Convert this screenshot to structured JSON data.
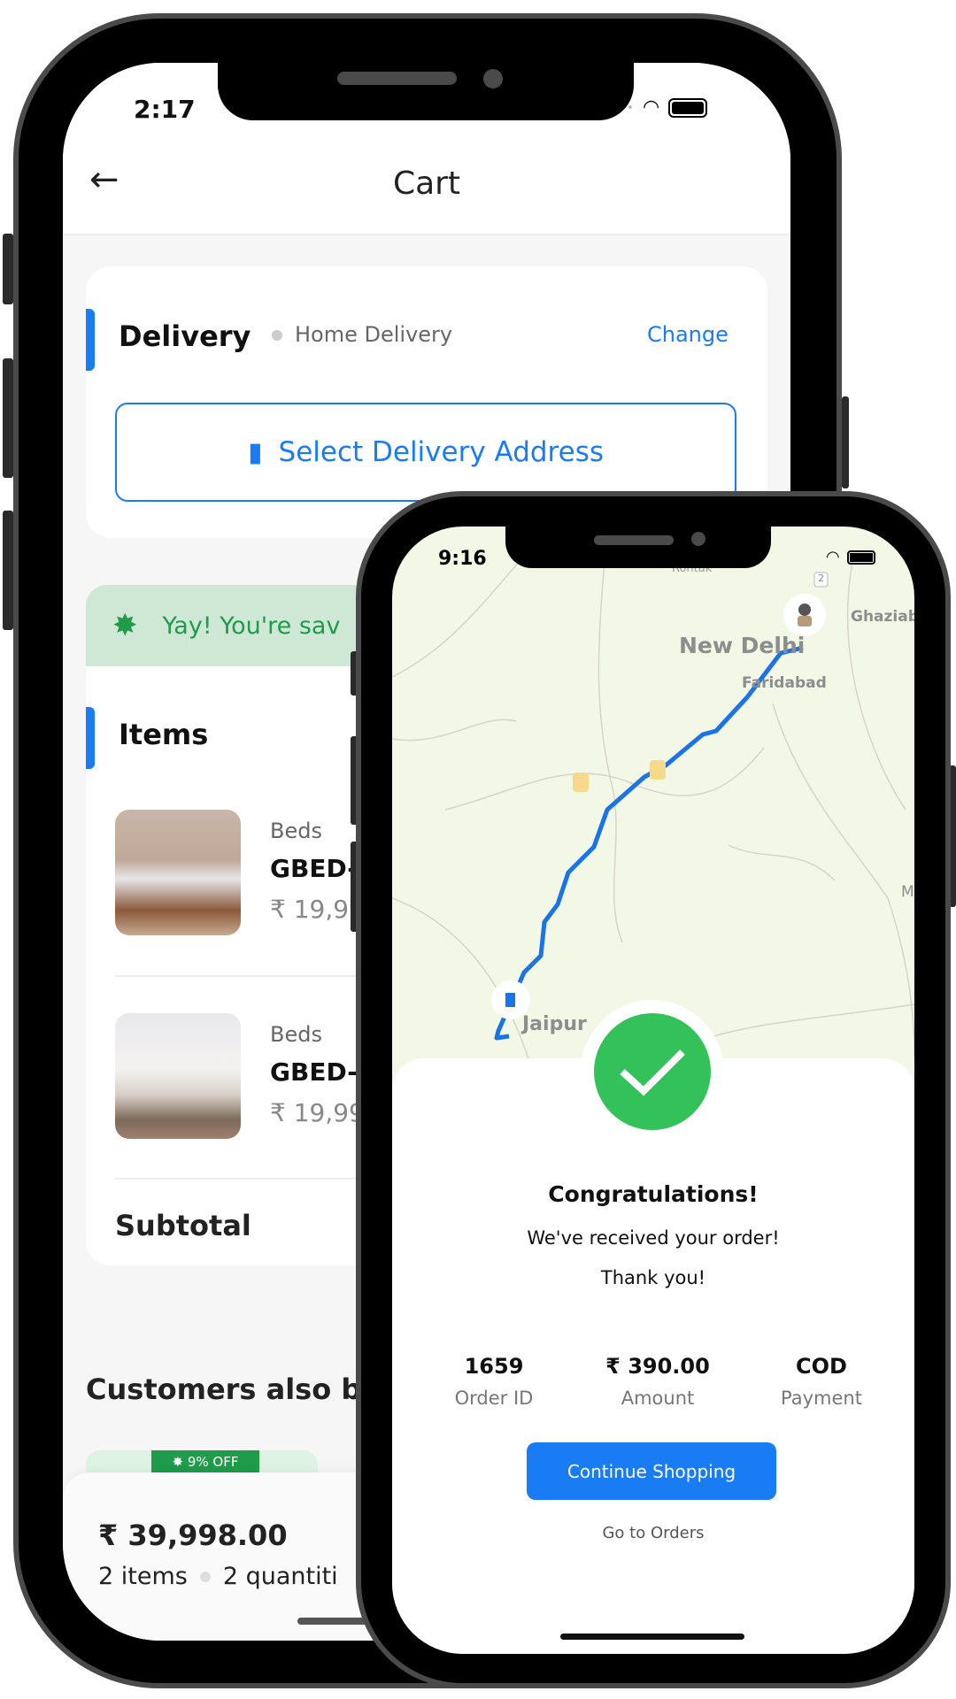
{
  "cart_phone": {
    "status_time": "2:17",
    "header": {
      "title": "Cart",
      "back_icon": "arrow-left-icon"
    },
    "delivery": {
      "title": "Delivery",
      "mode": "Home Delivery",
      "change_label": "Change",
      "select_address_label": "Select Delivery Address",
      "address_icon": "map-icon"
    },
    "savings_banner": {
      "text": "Yay! You're sav",
      "icon": "discount-badge-icon"
    },
    "items_title": "Items",
    "items": [
      {
        "category": "Beds",
        "name": "GBED-",
        "price": "₹ 19,99"
      },
      {
        "category": "Beds",
        "name": "GBED-",
        "price": "₹ 19,99"
      }
    ],
    "subtotal_label": "Subtotal",
    "also_bought_title": "Customers also b",
    "discount_badge": "9% OFF",
    "footer": {
      "total": "₹ 39,998.00",
      "items": "2 items",
      "quantity": "2 quantiti"
    },
    "colors": {
      "accent": "#1a7cf5",
      "banner_bg": "#cfe8d6",
      "banner_text": "#1e9c4a"
    }
  },
  "order_phone": {
    "status_time": "9:16",
    "map": {
      "labels": {
        "delhi": "New Delhi",
        "faridabad": "Faridabad",
        "ghaziabad": "Ghaziab",
        "jaipur": "Jaipur",
        "rohtak": "Rohtak",
        "road_badge": "2",
        "m": "M"
      }
    },
    "success": {
      "title": "Congratulations!",
      "line1": "We've received your order!",
      "line2": "Thank you!",
      "stats": [
        {
          "value": "1659",
          "label": "Order ID"
        },
        {
          "value": "₹ 390.00",
          "label": "Amount"
        },
        {
          "value": "COD",
          "label": "Payment"
        }
      ],
      "continue_label": "Continue Shopping",
      "orders_label": "Go to Orders"
    },
    "colors": {
      "success": "#33c159",
      "route": "#1a73e8",
      "button": "#1a7cf5"
    }
  }
}
